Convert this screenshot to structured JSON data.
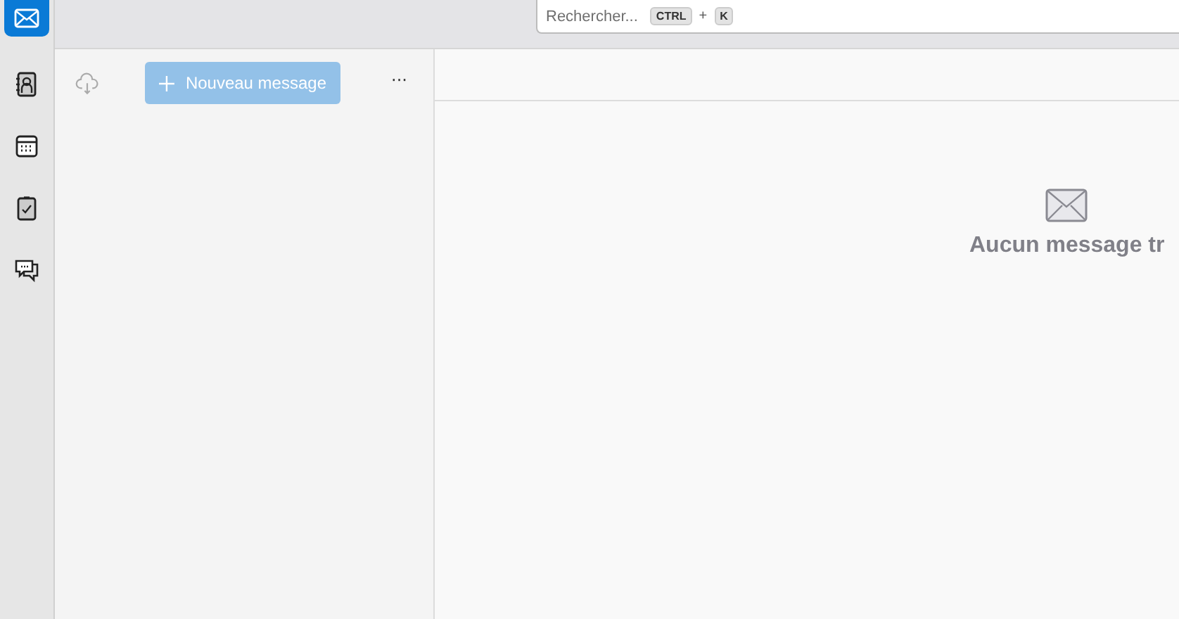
{
  "nav_rail": {
    "items": [
      {
        "kind": "mail",
        "selected": true
      },
      {
        "kind": "contacts",
        "selected": false
      },
      {
        "kind": "calendar",
        "selected": false
      },
      {
        "kind": "tasks",
        "selected": false
      },
      {
        "kind": "chat",
        "selected": false
      }
    ]
  },
  "search": {
    "placeholder": "Rechercher...",
    "shortcut": [
      "CTRL",
      "+",
      "K"
    ]
  },
  "folder_pane": {
    "new_message_button": {
      "label": "Nouveau message",
      "disabled": true
    },
    "more_button": "···"
  },
  "message_view": {
    "empty_text": "Aucun message tr"
  }
}
